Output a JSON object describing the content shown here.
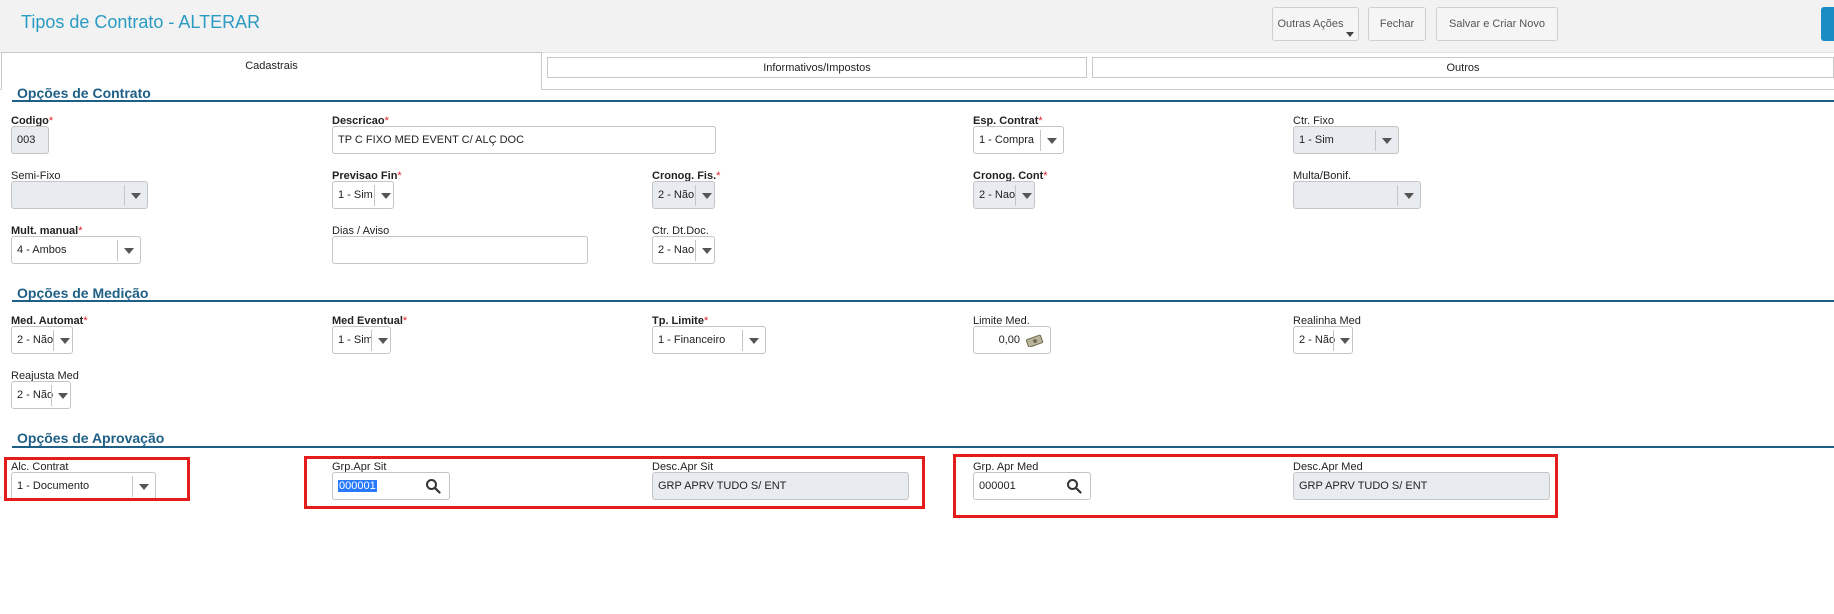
{
  "header": {
    "title": "Tipos de Contrato - ALTERAR",
    "buttons": {
      "outras_acoes": "Outras Ações",
      "fechar": "Fechar",
      "salvar_criar": "Salvar e Criar Novo"
    }
  },
  "tabs": [
    "Cadastrais",
    "Informativos/Impostos",
    "Outros"
  ],
  "sections": {
    "contrato": "Opções de Contrato",
    "medicao": "Opções de Medição",
    "aprovacao": "Opções de Aprovação"
  },
  "required_marker": "*",
  "fields": {
    "codigo": {
      "label": "Codigo",
      "value": "003"
    },
    "descricao": {
      "label": "Descricao",
      "value": "TP C FIXO MED EVENT C/ ALÇ DOC"
    },
    "esp_contrat": {
      "label": "Esp. Contrat",
      "value": "1 - Compra"
    },
    "ctr_fixo": {
      "label": "Ctr. Fixo",
      "value": "1 - Sim"
    },
    "semi_fixo": {
      "label": "Semi-Fixo",
      "value": ""
    },
    "previsao_fin": {
      "label": "Previsao Fin",
      "value": "1 - Sim"
    },
    "cronog_fis": {
      "label": "Cronog. Fis.",
      "value": "2 - Não"
    },
    "cronog_cont": {
      "label": "Cronog. Cont",
      "value": "2 - Nao"
    },
    "multa_bonif": {
      "label": "Multa/Bonif.",
      "value": ""
    },
    "mult_manual": {
      "label": "Mult. manual",
      "value": "4 - Ambos"
    },
    "dias_aviso": {
      "label": "Dias / Aviso",
      "value": ""
    },
    "ctr_dt_doc": {
      "label": "Ctr. Dt.Doc.",
      "value": "2 - Nao"
    },
    "med_automat": {
      "label": "Med. Automat",
      "value": "2 - Não"
    },
    "med_eventual": {
      "label": "Med Eventual",
      "value": "1 - Sim"
    },
    "tp_limite": {
      "label": "Tp. Limite",
      "value": "1 - Financeiro"
    },
    "limite_med": {
      "label": "Limite Med.",
      "value": "0,00"
    },
    "realinha_med": {
      "label": "Realinha Med",
      "value": "2 - Não"
    },
    "reajusta_med": {
      "label": "Reajusta Med",
      "value": "2 - Não"
    },
    "alc_contrat": {
      "label": "Alc. Contrat",
      "value": "1 - Documento"
    },
    "grp_apr_sit": {
      "label": "Grp.Apr Sit",
      "value": "000001"
    },
    "desc_apr_sit": {
      "label": "Desc.Apr Sit",
      "value": "GRP APRV TUDO S/ ENT"
    },
    "grp_apr_med": {
      "label": "Grp. Apr Med",
      "value": "000001"
    },
    "desc_apr_med": {
      "label": "Desc.Apr Med",
      "value": "GRP APRV TUDO S/ ENT"
    }
  },
  "icons": {
    "search": "search-icon",
    "money": "money-icon",
    "dropdown": "chevron-down-icon"
  },
  "colors": {
    "accent": "#2a9bc3",
    "section": "#1e5f86",
    "highlight_box": "#e41c1c",
    "required": "#e0202a"
  }
}
